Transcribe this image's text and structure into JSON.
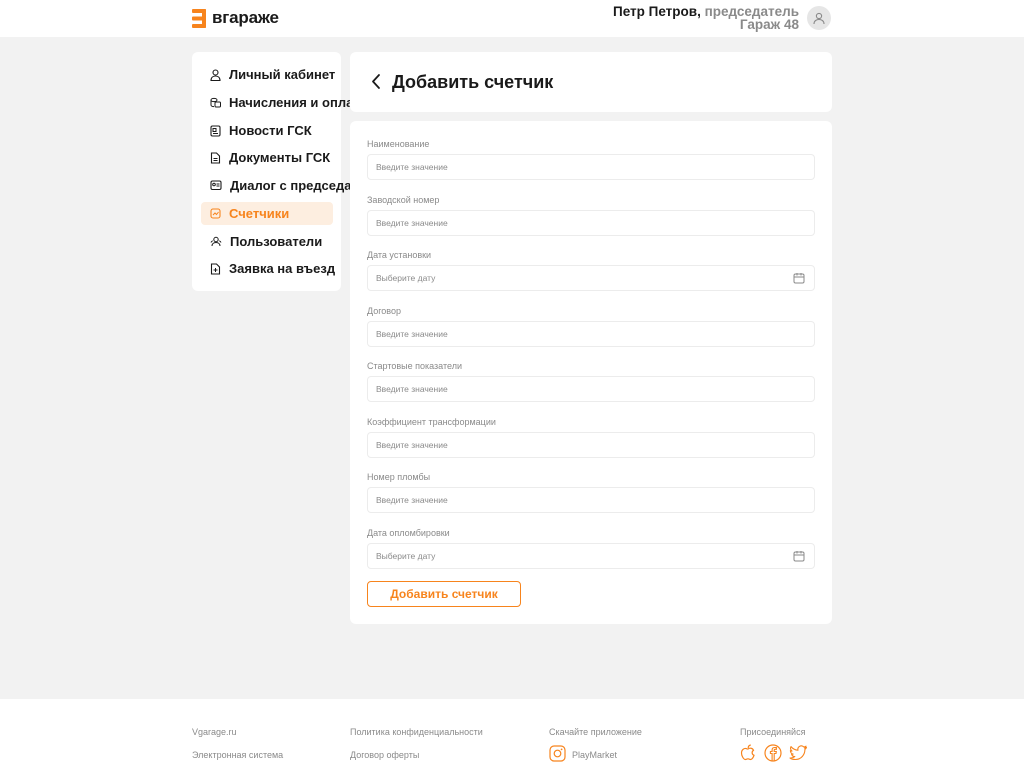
{
  "header": {
    "logo_text": "вгараже",
    "user_name": "Петр Петров,",
    "user_role": "председатель",
    "garage": "Гараж 48"
  },
  "sidebar": {
    "items": [
      {
        "label": "Личный кабинет",
        "icon": "user-icon"
      },
      {
        "label": "Начисления и оплата",
        "icon": "coins-icon"
      },
      {
        "label": "Новости ГСК",
        "icon": "news-icon"
      },
      {
        "label": "Документы ГСК",
        "icon": "document-icon"
      },
      {
        "label": "Диалог с председателем",
        "icon": "dialog-icon"
      },
      {
        "label": "Счетчики",
        "icon": "meter-icon",
        "active": true
      },
      {
        "label": "Пользователи",
        "icon": "users-icon"
      },
      {
        "label": "Заявка на въезд",
        "icon": "request-icon"
      }
    ]
  },
  "page": {
    "title": "Добавить счетчик"
  },
  "form": {
    "fields": [
      {
        "label": "Наименование",
        "placeholder": "Введите значение"
      },
      {
        "label": "Заводской номер",
        "placeholder": "Введите значение"
      },
      {
        "label": "Дата установки",
        "placeholder": "Выберите дату",
        "calendar": true
      },
      {
        "label": "Договор",
        "placeholder": "Введите значение"
      },
      {
        "label": "Стартовые показатели",
        "placeholder": "Введите значение"
      },
      {
        "label": "Коэффициент трансформации",
        "placeholder": "Введите значение"
      },
      {
        "label": "Номер пломбы",
        "placeholder": "Введите значение"
      },
      {
        "label": "Дата опломбировки",
        "placeholder": "Выберите дату",
        "calendar": true
      }
    ],
    "submit_label": "Добавить счетчик"
  },
  "footer": {
    "site": "Vgarage.ru",
    "tagline": "Электронная система",
    "privacy": "Политика конфиденциальности",
    "offer": "Договор оферты",
    "download": "Скачайте приложение",
    "playmarket": "PlayMarket",
    "join": "Присоединяйся"
  },
  "colors": {
    "accent": "#f7841d",
    "active_bg": "#fdeee0",
    "page_bg": "#f2f2f2",
    "muted_text": "#8a8a8a"
  }
}
